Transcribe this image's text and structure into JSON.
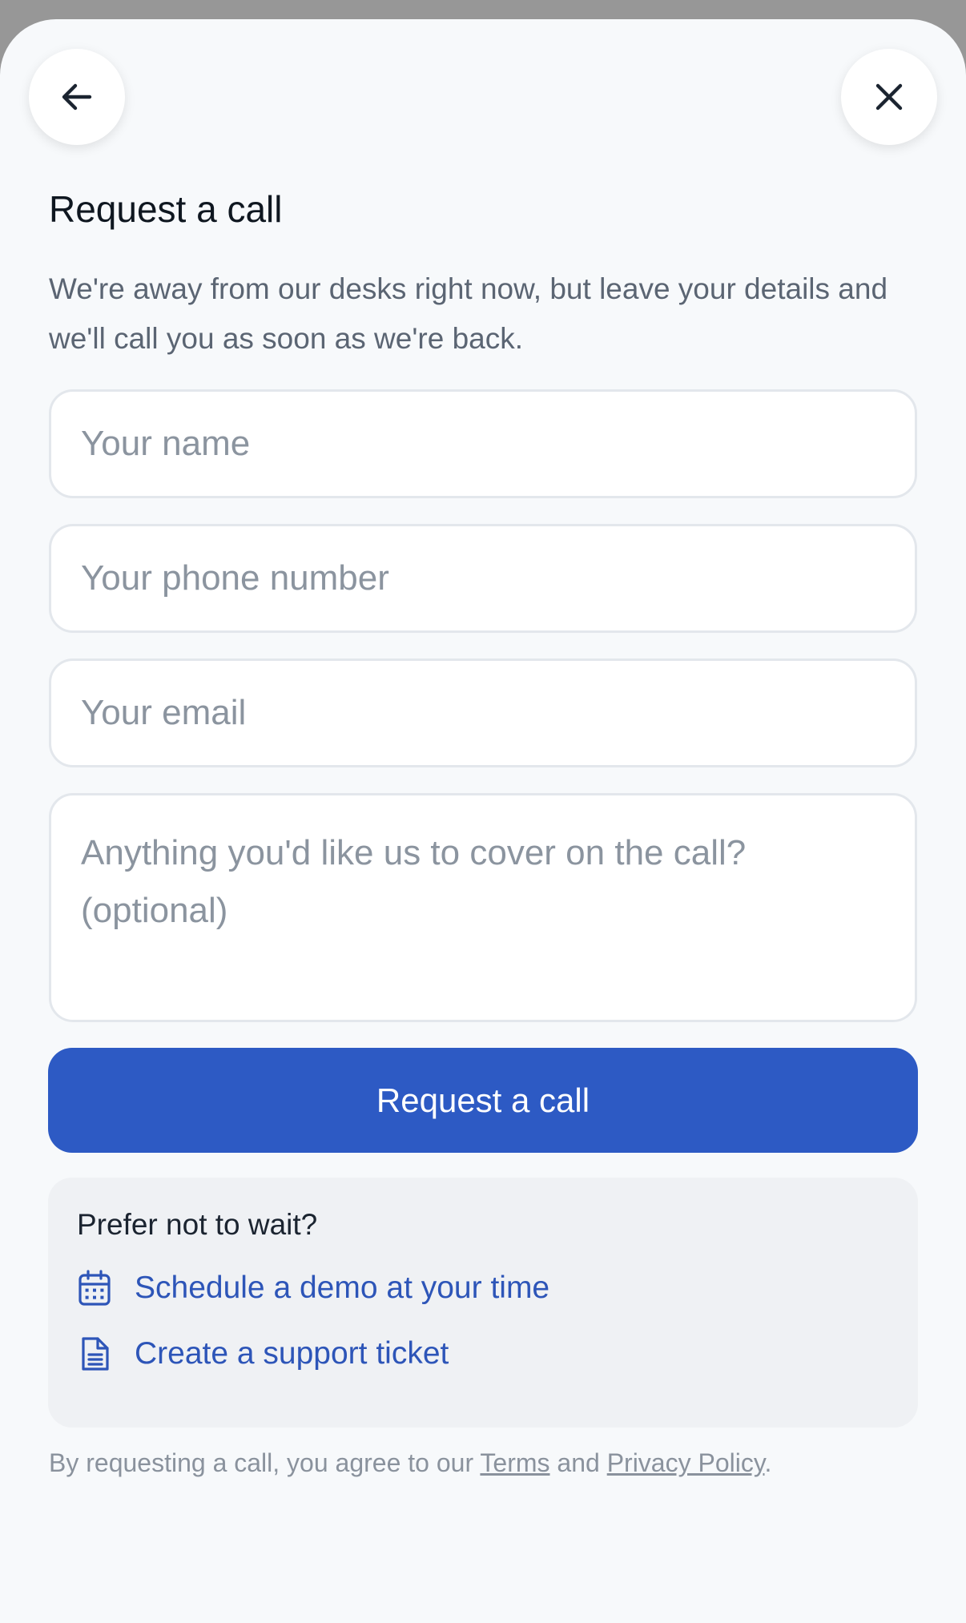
{
  "header": {
    "back_icon": "arrow-left-icon",
    "close_icon": "close-icon"
  },
  "form": {
    "title": "Request a call",
    "description": "We're away from our desks right now, but leave your details and we'll call you as soon as we're back.",
    "name_placeholder": "Your name",
    "name_value": "",
    "phone_placeholder": "Your phone number",
    "phone_value": "",
    "email_placeholder": "Your email",
    "email_value": "",
    "notes_placeholder": "Anything you'd like us to cover on the call? (optional)",
    "notes_value": "",
    "submit_label": "Request a call"
  },
  "alternatives": {
    "heading": "Prefer not to wait?",
    "items": [
      {
        "label": "Schedule a demo at your time",
        "icon": "calendar-icon"
      },
      {
        "label": "Create a support ticket",
        "icon": "document-icon"
      }
    ]
  },
  "legal": {
    "prefix": "By requesting a call, you agree to our ",
    "terms_label": "Terms",
    "middle": " and ",
    "privacy_label": "Privacy Policy",
    "suffix": "."
  },
  "colors": {
    "accent": "#2d5ac4",
    "link": "#2d55b8",
    "background": "#f7f9fb",
    "card": "#eff1f4"
  }
}
